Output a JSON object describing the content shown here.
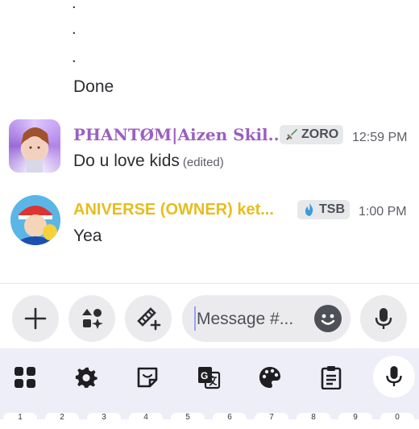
{
  "messages": {
    "dots": [
      ".",
      ".",
      "."
    ],
    "done_text": "Done",
    "items": [
      {
        "username": "PHANTØM|Aizen Skil...",
        "username_color": "#9c5fc0",
        "tag": {
          "icon": "sword-icon",
          "label": "ZORO"
        },
        "time": "12:59 PM",
        "text": "Do u love kids",
        "edited": "(edited)"
      },
      {
        "username": "ANIVERSE (OWNER) ket...",
        "username_color": "#e6bd1e",
        "tag": {
          "icon": "blue-flame-icon",
          "label": "TSB"
        },
        "time": "1:00 PM",
        "text": "Yea",
        "edited": ""
      }
    ]
  },
  "composer": {
    "placeholder": "Message #...",
    "buttons": [
      "plus-icon",
      "apps-icon",
      "gift-sparkle-icon",
      "emoji-icon",
      "microphone-icon"
    ]
  },
  "keyboard_toolbar": {
    "icons": [
      "grid-apps-icon",
      "settings-gear-icon",
      "sticker-icon",
      "translate-icon",
      "palette-icon",
      "clipboard-icon",
      "microphone-icon"
    ]
  },
  "keyboard_keys": [
    "1",
    "2",
    "3",
    "4",
    "5",
    "6",
    "7",
    "8",
    "9",
    "0"
  ],
  "colors": {
    "accent": "#5865f2",
    "keyboard_bg": "#eeeef8",
    "button_bg": "#ebebee"
  }
}
